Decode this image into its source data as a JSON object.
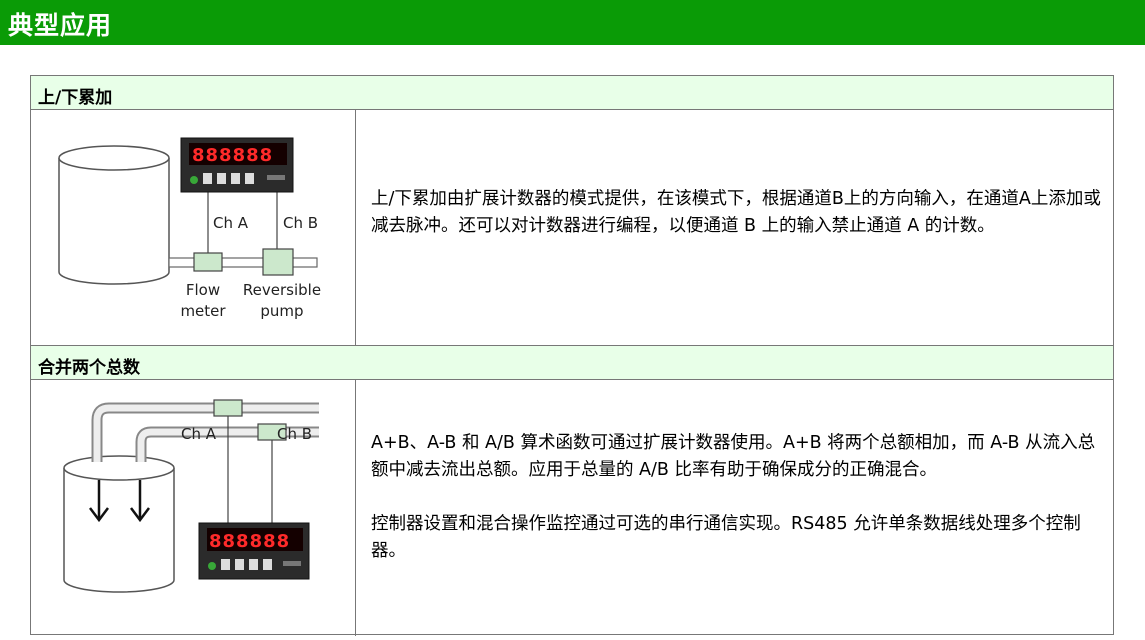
{
  "header": {
    "title": "典型应用"
  },
  "sections": [
    {
      "title": "上/下累加",
      "diagram": {
        "display_value": "888888",
        "ch_a": "Ch A",
        "ch_b": "Ch B",
        "flow_meter_line1": "Flow",
        "flow_meter_line2": "meter",
        "pump_line1": "Reversible",
        "pump_line2": "pump"
      },
      "paragraphs": [
        "上/下累加由扩展计数器的模式提供，在该模式下，根据通道B上的方向输入，在通道A上添加或减去脉冲。还可以对计数器进行编程，以便通道 B 上的输入禁止通道 A 的计数。"
      ]
    },
    {
      "title": "合并两个总数",
      "diagram": {
        "display_value": "888888",
        "ch_a": "Ch A",
        "ch_b": "Ch B"
      },
      "paragraphs": [
        "A+B、A-B 和 A/B 算术函数可通过扩展计数器使用。A+B 将两个总额相加，而 A-B 从流入总额中减去流出总额。应用于总量的 A/B 比率有助于确保成分的正确混合。",
        "控制器设置和混合操作监控通过可选的串行通信实现。RS485 允许单条数据线处理多个控制器。"
      ]
    }
  ],
  "colors": {
    "header_green": "#0a9b06",
    "section_bg": "#e8ffe8",
    "display_red": "#ff2a2a",
    "box_green": "#cce8cc"
  }
}
